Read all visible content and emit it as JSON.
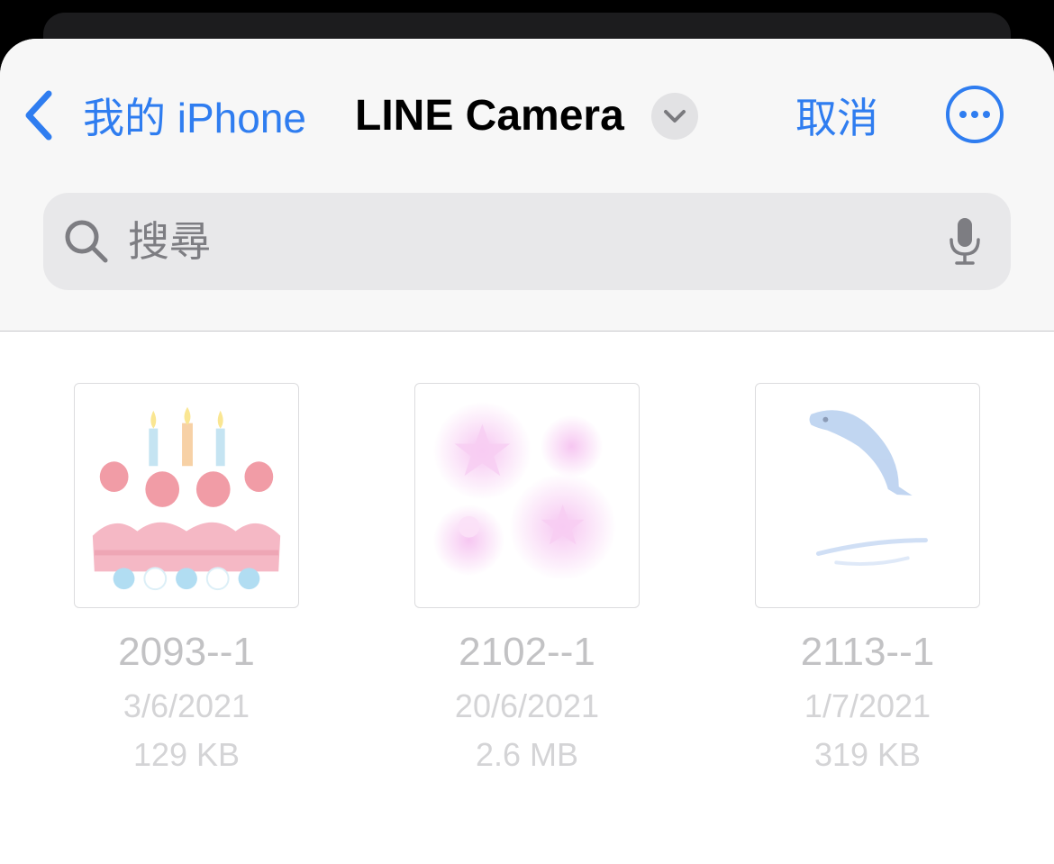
{
  "header": {
    "back_label": "我的 iPhone",
    "title": "LINE Camera",
    "cancel_label": "取消"
  },
  "icons": {
    "back": "chevron-left-icon",
    "title_menu": "chevron-down-icon",
    "more": "ellipsis-circle-icon",
    "search": "magnifying-glass-icon",
    "mic": "microphone-icon"
  },
  "search": {
    "placeholder": "搜尋",
    "value": ""
  },
  "colors": {
    "accent": "#2f7df0",
    "header_bg": "#f7f7f7",
    "search_bg": "#e8e8ea",
    "file_text_dim": "#c2c2c4"
  },
  "files": [
    {
      "name": "2093--1",
      "date": "3/6/2021",
      "size": "129 KB",
      "thumbnail": "birthday-cake-sticker"
    },
    {
      "name": "2102--1",
      "date": "20/6/2021",
      "size": "2.6 MB",
      "thumbnail": "pink-stars-sparkle"
    },
    {
      "name": "2113--1",
      "date": "1/7/2021",
      "size": "319 KB",
      "thumbnail": "dolphin-jumping"
    }
  ]
}
